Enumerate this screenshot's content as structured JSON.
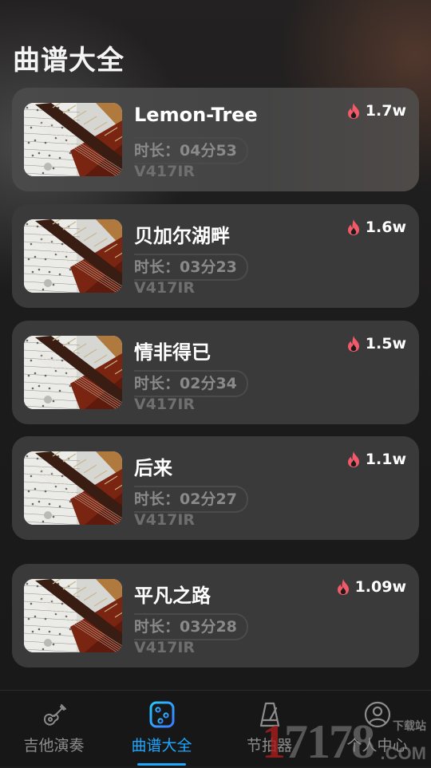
{
  "header": {
    "title": "曲谱大全"
  },
  "songs": [
    {
      "title": "Lemon-Tree",
      "duration": "时长：04分53",
      "code": "V417IR",
      "hot": "1.7w"
    },
    {
      "title": "贝加尔湖畔",
      "duration": "时长：03分23",
      "code": "V417IR",
      "hot": "1.6w"
    },
    {
      "title": "情非得已",
      "duration": "时长：02分34",
      "code": "V417IR",
      "hot": "1.5w"
    },
    {
      "title": "后来",
      "duration": "时长：02分27",
      "code": "V417IR",
      "hot": "1.1w"
    },
    {
      "title": "平凡之路",
      "duration": "时长：03分28",
      "code": "V417IR",
      "hot": "1.09w"
    }
  ],
  "tabbar": {
    "tabs": [
      {
        "label": "吉他演奏",
        "icon": "guitar-icon",
        "active": false
      },
      {
        "label": "曲谱大全",
        "icon": "score-icon",
        "active": true
      },
      {
        "label": "节拍器",
        "icon": "metronome-icon",
        "active": false
      },
      {
        "label": "个人中心",
        "icon": "user-icon",
        "active": false
      }
    ]
  },
  "watermark": {
    "digits": "17178",
    "site": ".COM",
    "tag": "下载站"
  },
  "colors": {
    "accent": "#1ea7ff",
    "flame": "#f25a6a",
    "card": "#3a3a3a",
    "muted_text": "#8a8a8a"
  }
}
